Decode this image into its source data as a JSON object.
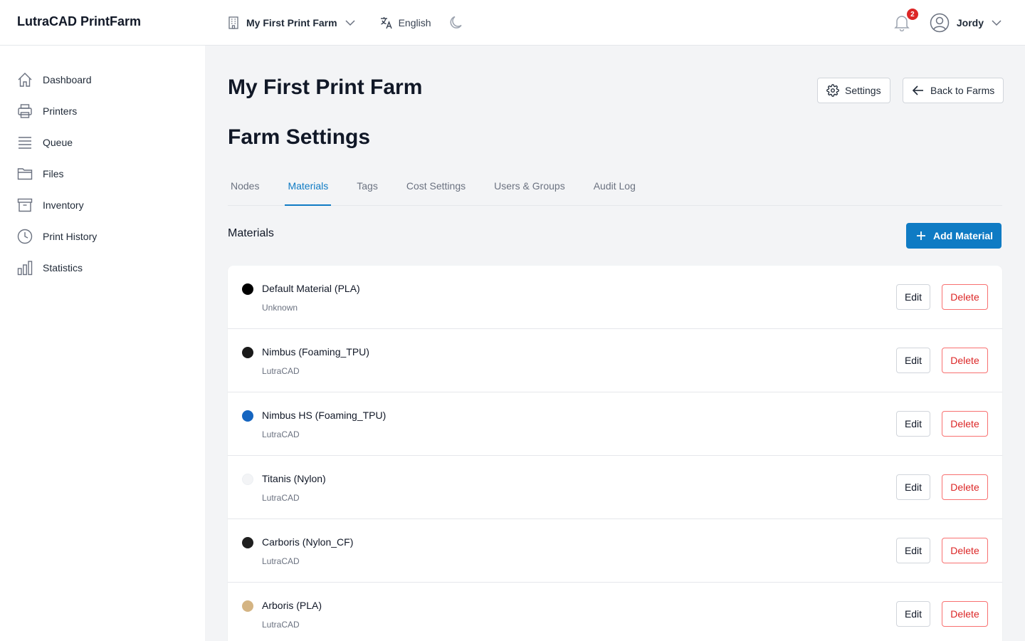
{
  "app": {
    "title": "LutraCAD PrintFarm"
  },
  "header": {
    "farm_selector": "My First Print Farm",
    "language": "English",
    "notifications_count": "2",
    "user_name": "Jordy"
  },
  "sidebar": {
    "items": [
      {
        "label": "Dashboard",
        "icon": "home-icon"
      },
      {
        "label": "Printers",
        "icon": "printer-icon"
      },
      {
        "label": "Queue",
        "icon": "queue-icon"
      },
      {
        "label": "Files",
        "icon": "folder-icon"
      },
      {
        "label": "Inventory",
        "icon": "archive-icon"
      },
      {
        "label": "Print History",
        "icon": "clock-icon"
      },
      {
        "label": "Statistics",
        "icon": "bar-chart-icon"
      }
    ]
  },
  "page": {
    "title": "My First Print Farm",
    "settings_label": "Settings",
    "back_label": "Back to Farms",
    "section_title": "Farm Settings",
    "tabs": [
      {
        "label": "Nodes",
        "active": false
      },
      {
        "label": "Materials",
        "active": true
      },
      {
        "label": "Tags",
        "active": false
      },
      {
        "label": "Cost Settings",
        "active": false
      },
      {
        "label": "Users & Groups",
        "active": false
      },
      {
        "label": "Audit Log",
        "active": false
      }
    ],
    "materials_heading": "Materials",
    "add_material_label": "Add Material"
  },
  "materials": [
    {
      "name": "Default Material (PLA)",
      "brand": "Unknown",
      "color": "#000000"
    },
    {
      "name": "Nimbus (Foaming_TPU)",
      "brand": "LutraCAD",
      "color": "#1a1a1a"
    },
    {
      "name": "Nimbus HS (Foaming_TPU)",
      "brand": "LutraCAD",
      "color": "#1565c0"
    },
    {
      "name": "Titanis (Nylon)",
      "brand": "LutraCAD",
      "color": "#f3f4f6"
    },
    {
      "name": "Carboris (Nylon_CF)",
      "brand": "LutraCAD",
      "color": "#1f1f1f"
    },
    {
      "name": "Arboris (PLA)",
      "brand": "LutraCAD",
      "color": "#d4b483"
    }
  ],
  "row_actions": {
    "edit": "Edit",
    "delete": "Delete"
  },
  "colors": {
    "accent": "#0f7bc4",
    "danger": "#dc2626"
  }
}
